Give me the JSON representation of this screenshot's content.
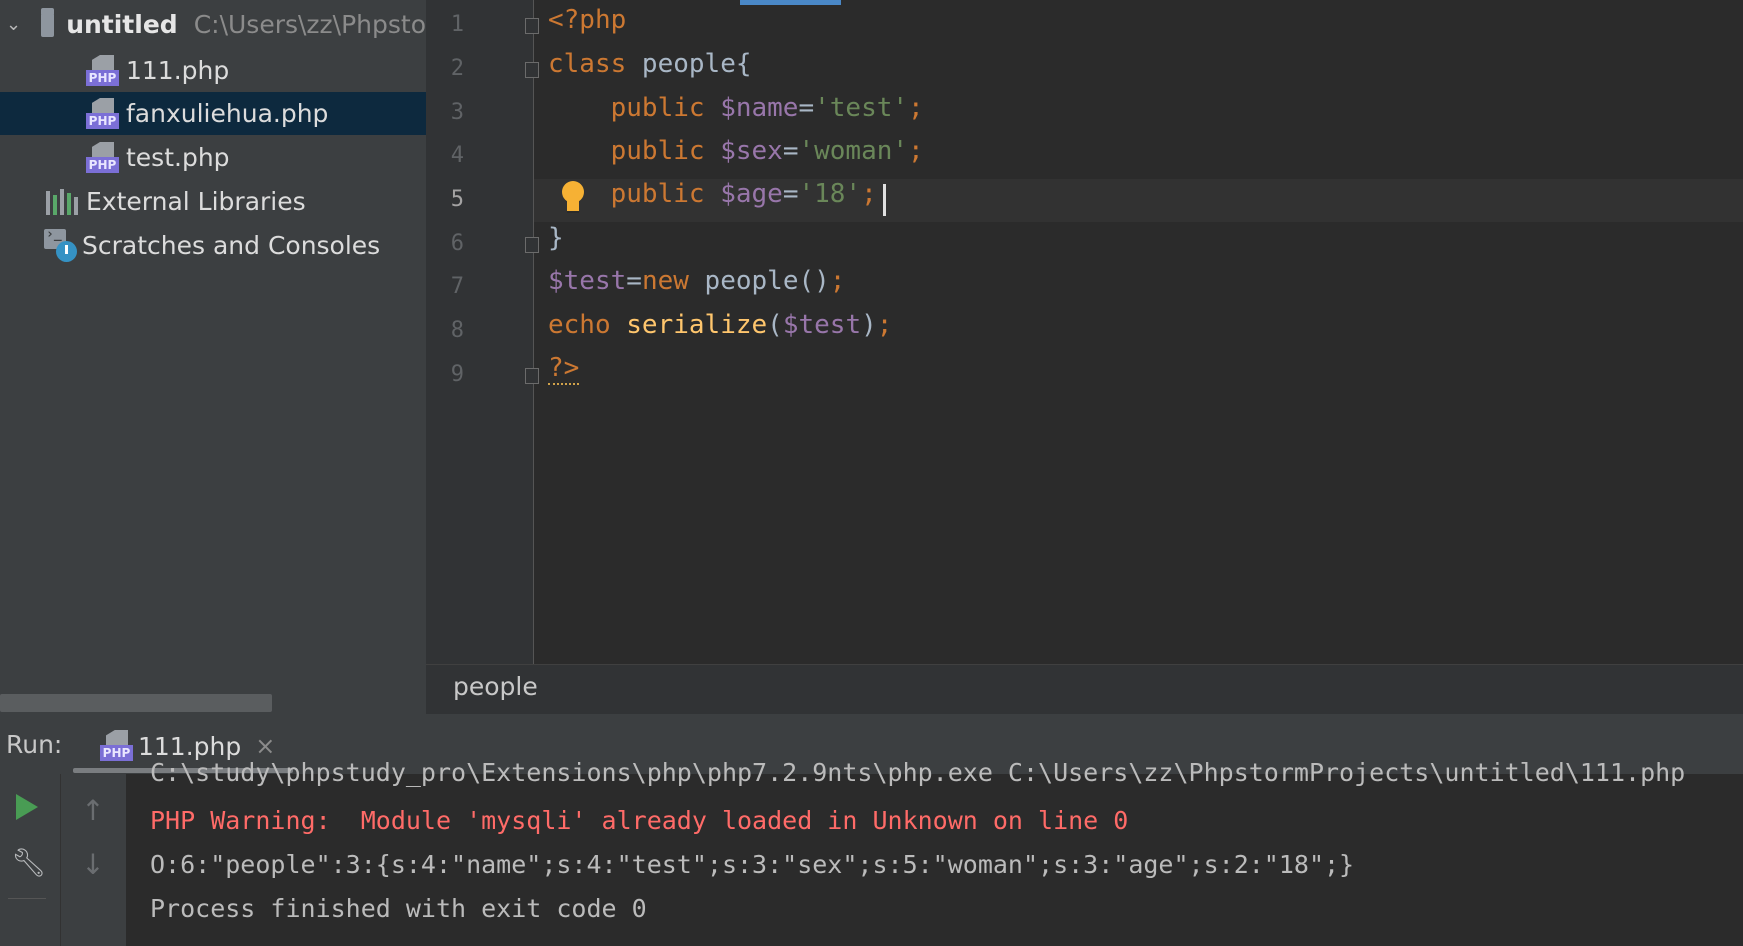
{
  "project": {
    "root": {
      "label": "untitled",
      "path": "C:\\Users\\zz\\Phpsto"
    },
    "files": [
      {
        "label": "111.php",
        "selected": false
      },
      {
        "label": "fanxuliehua.php",
        "selected": true
      },
      {
        "label": "test.php",
        "selected": false
      }
    ],
    "external_libraries": "External Libraries",
    "scratches": "Scratches and Consoles"
  },
  "editor": {
    "line_numbers": [
      "1",
      "2",
      "3",
      "4",
      "5",
      "6",
      "7",
      "8",
      "9"
    ],
    "current_line": 5,
    "lines": {
      "l1": "<?php",
      "l2_kw": "class",
      "l2_name": " people{",
      "l3_kw": "    public ",
      "l3_var": "$name",
      "l3_eq": "=",
      "l3_str": "'test'",
      "l3_end": ";",
      "l4_kw": "    public ",
      "l4_var": "$sex",
      "l4_eq": "=",
      "l4_str": "'woman'",
      "l4_end": ";",
      "l5_kw": "    public ",
      "l5_var": "$age",
      "l5_eq": "=",
      "l5_str": "'18'",
      "l5_end": ";",
      "l6": "}",
      "l7_var": "$test",
      "l7_eq": "=",
      "l7_kw": "new",
      "l7_rest": " people()",
      "l7_end": ";",
      "l8_kw": "echo ",
      "l8_fn": "serialize",
      "l8_open": "(",
      "l8_var": "$test",
      "l8_close": ")",
      "l8_end": ";",
      "l9": "?>"
    },
    "breadcrumb": "people"
  },
  "run": {
    "label": "Run:",
    "tab": "111.php",
    "close": "×",
    "output": [
      "C:\\study\\phpstudy_pro\\Extensions\\php\\php7.2.9nts\\php.exe C:\\Users\\zz\\PhpstormProjects\\untitled\\111.php",
      "PHP Warning:  Module 'mysqli' already loaded in Unknown on line 0",
      "O:6:\"people\":3:{s:4:\"name\";s:4:\"test\";s:3:\"sex\";s:5:\"woman\";s:3:\"age\";s:2:\"18\";}",
      "Process finished with exit code 0"
    ]
  },
  "colors": {
    "keyword": "#cc7832",
    "variable": "#9876aa",
    "string": "#6a8759",
    "function": "#ffc66d",
    "error": "#ff6b68",
    "selection": "#0d293e",
    "run": "#499c54"
  },
  "icons": [
    "chevron-down-icon",
    "folder-icon",
    "php-file-icon",
    "library-icon",
    "scratches-icon",
    "bulb-icon",
    "play-icon",
    "wrench-icon",
    "arrow-up-icon",
    "arrow-down-icon",
    "close-icon"
  ]
}
